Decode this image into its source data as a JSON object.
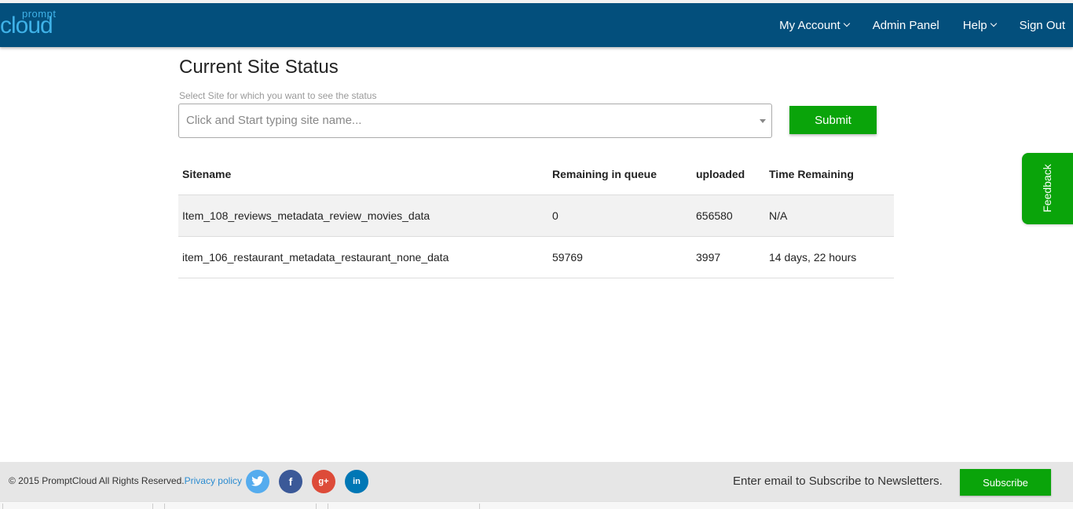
{
  "logo": {
    "top_text": "prompt",
    "main_text": "cloud"
  },
  "nav": {
    "items": [
      {
        "label": "My Account",
        "dropdown": true
      },
      {
        "label": "Admin Panel",
        "dropdown": false
      },
      {
        "label": "Help",
        "dropdown": true
      },
      {
        "label": "Sign Out",
        "dropdown": false
      }
    ]
  },
  "main": {
    "title": "Current Site Status",
    "helper": "Select Site for which you want to see the status",
    "site_select_placeholder": "Click and Start typing site name...",
    "submit_label": "Submit"
  },
  "table": {
    "headers": [
      "Sitename",
      "Remaining in queue",
      "uploaded",
      "Time Remaining"
    ],
    "rows": [
      [
        "Item_108_reviews_metadata_review_movies_data",
        "0",
        "656580",
        "N/A"
      ],
      [
        "item_106_restaurant_metadata_restaurant_none_data",
        "59769",
        "3997",
        "14 days, 22 hours"
      ]
    ]
  },
  "feedback": {
    "label": "Feedback"
  },
  "footer": {
    "copyright": "© 2015 PromptCloud All Rights Reserved.",
    "privacy_link": "Privacy policy",
    "social": [
      {
        "name": "twitter",
        "glyph": "t",
        "color": "#55acee"
      },
      {
        "name": "facebook",
        "glyph": "f",
        "color": "#3b5998"
      },
      {
        "name": "google-plus",
        "glyph": "g+",
        "color": "#dd4b39"
      },
      {
        "name": "linkedin",
        "glyph": "in",
        "color": "#0077b5"
      }
    ],
    "newsletter_text": "Enter email to Subscribe to Newsletters.",
    "subscribe_label": "Subscribe"
  },
  "colors": {
    "navbar": "#034f7c",
    "accent_green": "#0aa40a",
    "logo": "#3fb2e8"
  }
}
